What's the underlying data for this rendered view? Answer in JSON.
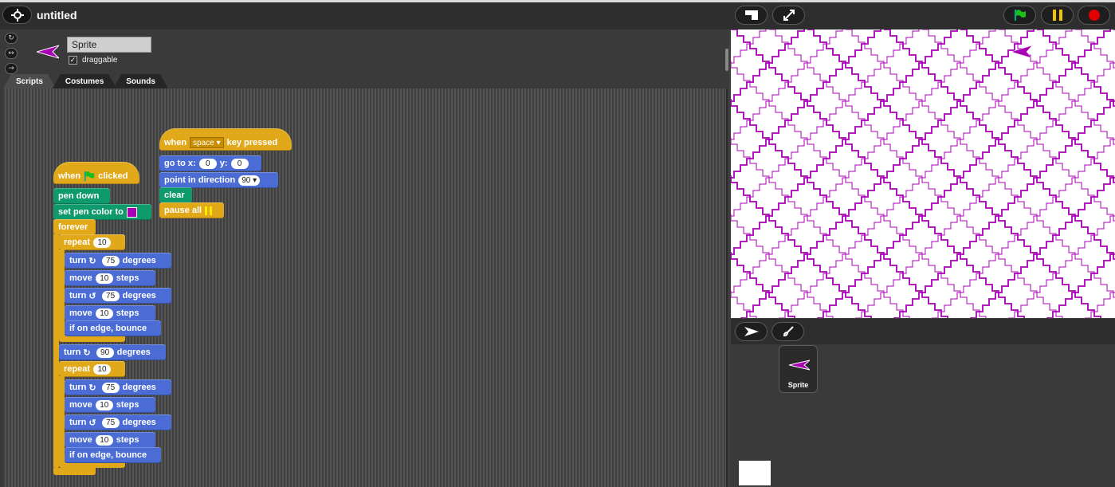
{
  "app": {
    "title": "untitled",
    "icons": [
      "gear-icon",
      "stage-size-icon",
      "fullscreen-icon",
      "green-flag-icon",
      "pause-icon",
      "stop-icon"
    ],
    "colors": {
      "pen": "#a800b4",
      "motion": "#4a6cd4",
      "control": "#e1a91a",
      "pen_block": "#0e9a6c"
    }
  },
  "sprite": {
    "name": "Sprite",
    "draggable_label": "draggable",
    "draggable_checked": "✓",
    "rotation_styles": [
      "↻",
      "↔",
      "→"
    ]
  },
  "tabs": [
    "Scripts",
    "Costumes",
    "Sounds"
  ],
  "scripts": {
    "space": {
      "when": "when",
      "key": "space",
      "key_pressed": "key pressed",
      "goto_label": "go to x:",
      "goto_x": "0",
      "goto_y_label": "y:",
      "goto_y": "0",
      "point_label": "point in direction",
      "point_value": "90",
      "clear": "clear",
      "pause_all": "pause all"
    },
    "flag": {
      "when": "when",
      "clicked": "clicked",
      "pen_down": "pen down",
      "set_pen_color": "set pen color to",
      "forever": "forever",
      "repeat": "repeat",
      "repeat_count": "10",
      "turn": "turn",
      "degrees": "degrees",
      "angle_75": "75",
      "angle_90": "90",
      "move": "move",
      "steps": "steps",
      "move_count": "10",
      "bounce": "if on edge, bounce"
    }
  },
  "corral": {
    "sprite_label": "Sprite"
  }
}
